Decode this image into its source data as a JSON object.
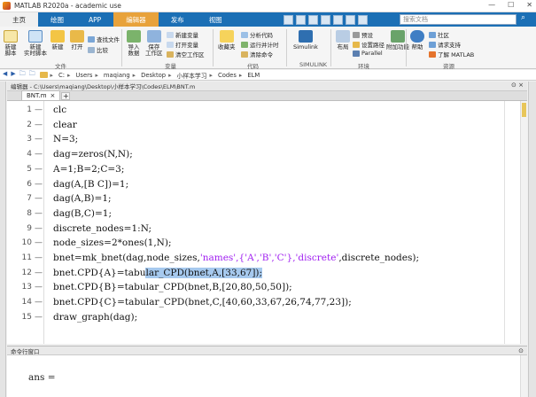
{
  "window": {
    "title": "MATLAB R2020a - academic use",
    "controls": [
      "—",
      "☐",
      "✕"
    ]
  },
  "tabs": [
    {
      "label": "主页",
      "state": "active"
    },
    {
      "label": "绘图",
      "state": "normal"
    },
    {
      "label": "APP",
      "state": "normal"
    },
    {
      "label": "编辑器",
      "state": "edit"
    },
    {
      "label": "发布",
      "state": "normal"
    },
    {
      "label": "视图",
      "state": "normal"
    }
  ],
  "search": {
    "placeholder": "搜索文档"
  },
  "ribbon": {
    "file": {
      "new_script": "新建\n脚本",
      "new_live": "新建\n实时脚本",
      "new": "新建",
      "open": "打开",
      "find_files": "查找文件",
      "compare": "比较",
      "group": "文件"
    },
    "variable": {
      "import": "导入\n数据",
      "save": "保存\n工作区",
      "new_var": "新建变量",
      "open_var": "打开变量",
      "clear_ws": "清空工作区",
      "group": "变量"
    },
    "code": {
      "fav": "收藏夹",
      "analyze": "分析代码",
      "run_time": "运行并计时",
      "clear_cmd": "清除命令",
      "group": "代码"
    },
    "simulink": {
      "label": "Simulink",
      "group": "SIMULINK"
    },
    "env": {
      "layout": "布局",
      "prefs": "预设",
      "set_path": "设置路径",
      "parallel": "Parallel",
      "addons": "附加功能",
      "group": "环境"
    },
    "resources": {
      "help": "帮助",
      "community": "社区",
      "support": "请求支持",
      "learn": "了解 MATLAB",
      "group": "资源"
    }
  },
  "address": {
    "nav": "◀ ▶ 🗀 🗀",
    "crumbs": [
      "C:",
      "Users",
      "maqiang",
      "Desktop",
      "小样本学习",
      "Codes",
      "ELM"
    ]
  },
  "editor": {
    "header": "编辑器 - C:\\Users\\maqiang\\Desktop\\小样本学习\\Codes\\ELM\\BNT.m",
    "file_tab": "BNT.m",
    "lines": [
      {
        "n": "1",
        "pre": "clc",
        "str": "",
        "post": ""
      },
      {
        "n": "2",
        "pre": "clear",
        "str": "",
        "post": ""
      },
      {
        "n": "3",
        "pre": "N=3;",
        "str": "",
        "post": ""
      },
      {
        "n": "4",
        "pre": "dag=zeros(N,N);",
        "str": "",
        "post": ""
      },
      {
        "n": "5",
        "pre": "A=1;B=2;C=3;",
        "str": "",
        "post": ""
      },
      {
        "n": "6",
        "pre": "dag(A,[B C])=1;",
        "str": "",
        "post": ""
      },
      {
        "n": "7",
        "pre": "dag(A,B)=1;",
        "str": "",
        "post": ""
      },
      {
        "n": "8",
        "pre": "dag(B,C)=1;",
        "str": "",
        "post": ""
      },
      {
        "n": "9",
        "pre": "discrete_nodes=1:N;",
        "str": "",
        "post": ""
      },
      {
        "n": "10",
        "pre": "node_sizes=2*ones(1,N);",
        "str": "",
        "post": ""
      },
      {
        "n": "11",
        "pre": "bnet=mk_bnet(dag,node_sizes,",
        "str": "'names',{'A','B','C'},'discrete'",
        "post": ",discrete_nodes);"
      },
      {
        "n": "12",
        "pre": "bnet.CPD{A}=tabu",
        "sel": "lar_CPD(bnet,A,[33,67]);",
        "str": "",
        "post": ""
      },
      {
        "n": "13",
        "pre": "bnet.CPD{B}=tabular_CPD(bnet,B,[20,80,50,50]);",
        "str": "",
        "post": ""
      },
      {
        "n": "14",
        "pre": "bnet.CPD{C}=tabular_CPD(bnet,C,[40,60,33,67,26,74,77,23]);",
        "str": "",
        "post": ""
      },
      {
        "n": "15",
        "pre": "draw_graph(dag);",
        "str": "",
        "post": ""
      }
    ]
  },
  "command": {
    "header": "命令行窗口",
    "output": "ans ="
  },
  "colors": {
    "accent": "#1b6fb5",
    "editor_tab": "#e8a23b",
    "string": "#a020f0",
    "selection": "#a6c9ee"
  }
}
